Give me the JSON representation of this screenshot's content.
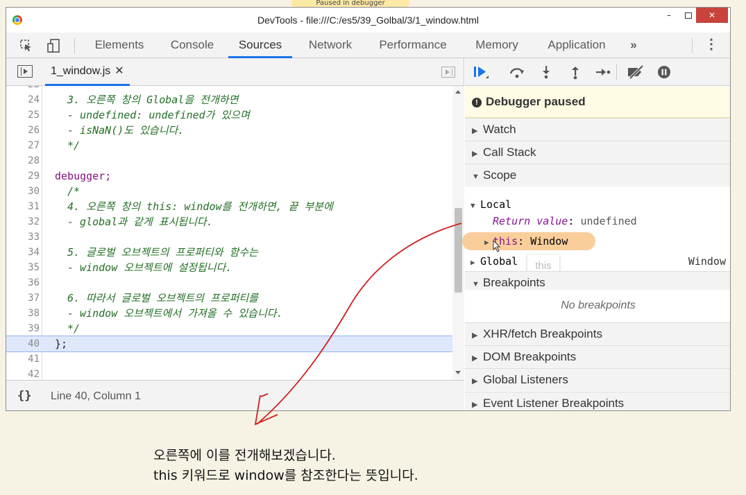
{
  "paused_banner": "Paused in debugger",
  "window": {
    "title": "DevTools - file:///C:/es5/39_Golbal/3/1_window.html",
    "minimize": "–",
    "close": "✕"
  },
  "toolbar": {
    "inspect_icon": "cursor-select-icon",
    "device_icon": "device-toggle-icon",
    "tabs": [
      "Elements",
      "Console",
      "Sources",
      "Network",
      "Performance",
      "Memory",
      "Application"
    ],
    "active_tab": "Sources",
    "more": "»",
    "menu": "⋮"
  },
  "editor": {
    "file_tab": "1_window.js",
    "close": "✕",
    "lines": [
      {
        "n": "23",
        "code": ""
      },
      {
        "n": "24",
        "code": "3. 오른쪽 창의 Global을 전개하면"
      },
      {
        "n": "25",
        "code": "- undefined: undefined가 있으며"
      },
      {
        "n": "26",
        "code": "- isNaN()도 있습니다."
      },
      {
        "n": "27",
        "code": "*/"
      },
      {
        "n": "28",
        "code": ""
      },
      {
        "n": "29",
        "code": "debugger;"
      },
      {
        "n": "30",
        "code": "/*"
      },
      {
        "n": "31",
        "code": "4. 오른쪽 창의 this: window를 전개하면, 끝 부분에"
      },
      {
        "n": "32",
        "code": "- global과 같게 표시됩니다."
      },
      {
        "n": "33",
        "code": ""
      },
      {
        "n": "34",
        "code": "5. 글로벌 오브젝트의 프로퍼티와 함수는"
      },
      {
        "n": "35",
        "code": "- window 오브젝트에 설정됩니다."
      },
      {
        "n": "36",
        "code": ""
      },
      {
        "n": "37",
        "code": "6. 따라서 글로벌 오브젝트의 프로퍼티를"
      },
      {
        "n": "38",
        "code": "- window 오브젝트에서 가져올 수 있습니다."
      },
      {
        "n": "39",
        "code": "*/"
      },
      {
        "n": "40",
        "code": "};"
      },
      {
        "n": "41",
        "code": ""
      },
      {
        "n": "42",
        "code": ""
      }
    ],
    "current_line": "40"
  },
  "status": {
    "pretty_print": "{}",
    "cursor": "Line 40, Column 1"
  },
  "debugger": {
    "paused_text": "Debugger paused",
    "sections": {
      "watch": "Watch",
      "call_stack": "Call Stack",
      "scope": "Scope",
      "breakpoints": "Breakpoints",
      "xhr": "XHR/fetch Breakpoints",
      "dom": "DOM Breakpoints",
      "global_listeners": "Global Listeners",
      "event_listener": "Event Listener Breakpoints"
    },
    "scope": {
      "local": "Local",
      "return_key": "Return value",
      "return_val": "undefined",
      "this_key": "this",
      "this_val": "Window",
      "global": "Global",
      "global_val": "Window",
      "tooltip": "this"
    },
    "no_breakpoints": "No breakpoints"
  },
  "caption": {
    "line1": "오른쪽에 이를 전개해보겠습니다.",
    "line2": "this 키워드로 window를 참조한다는 뜻입니다."
  },
  "colors": {
    "accent": "#1a73e8",
    "comment": "#236e25",
    "keyword": "#881280",
    "highlight": "#f8c58a",
    "annotation": "#d01e1e"
  }
}
